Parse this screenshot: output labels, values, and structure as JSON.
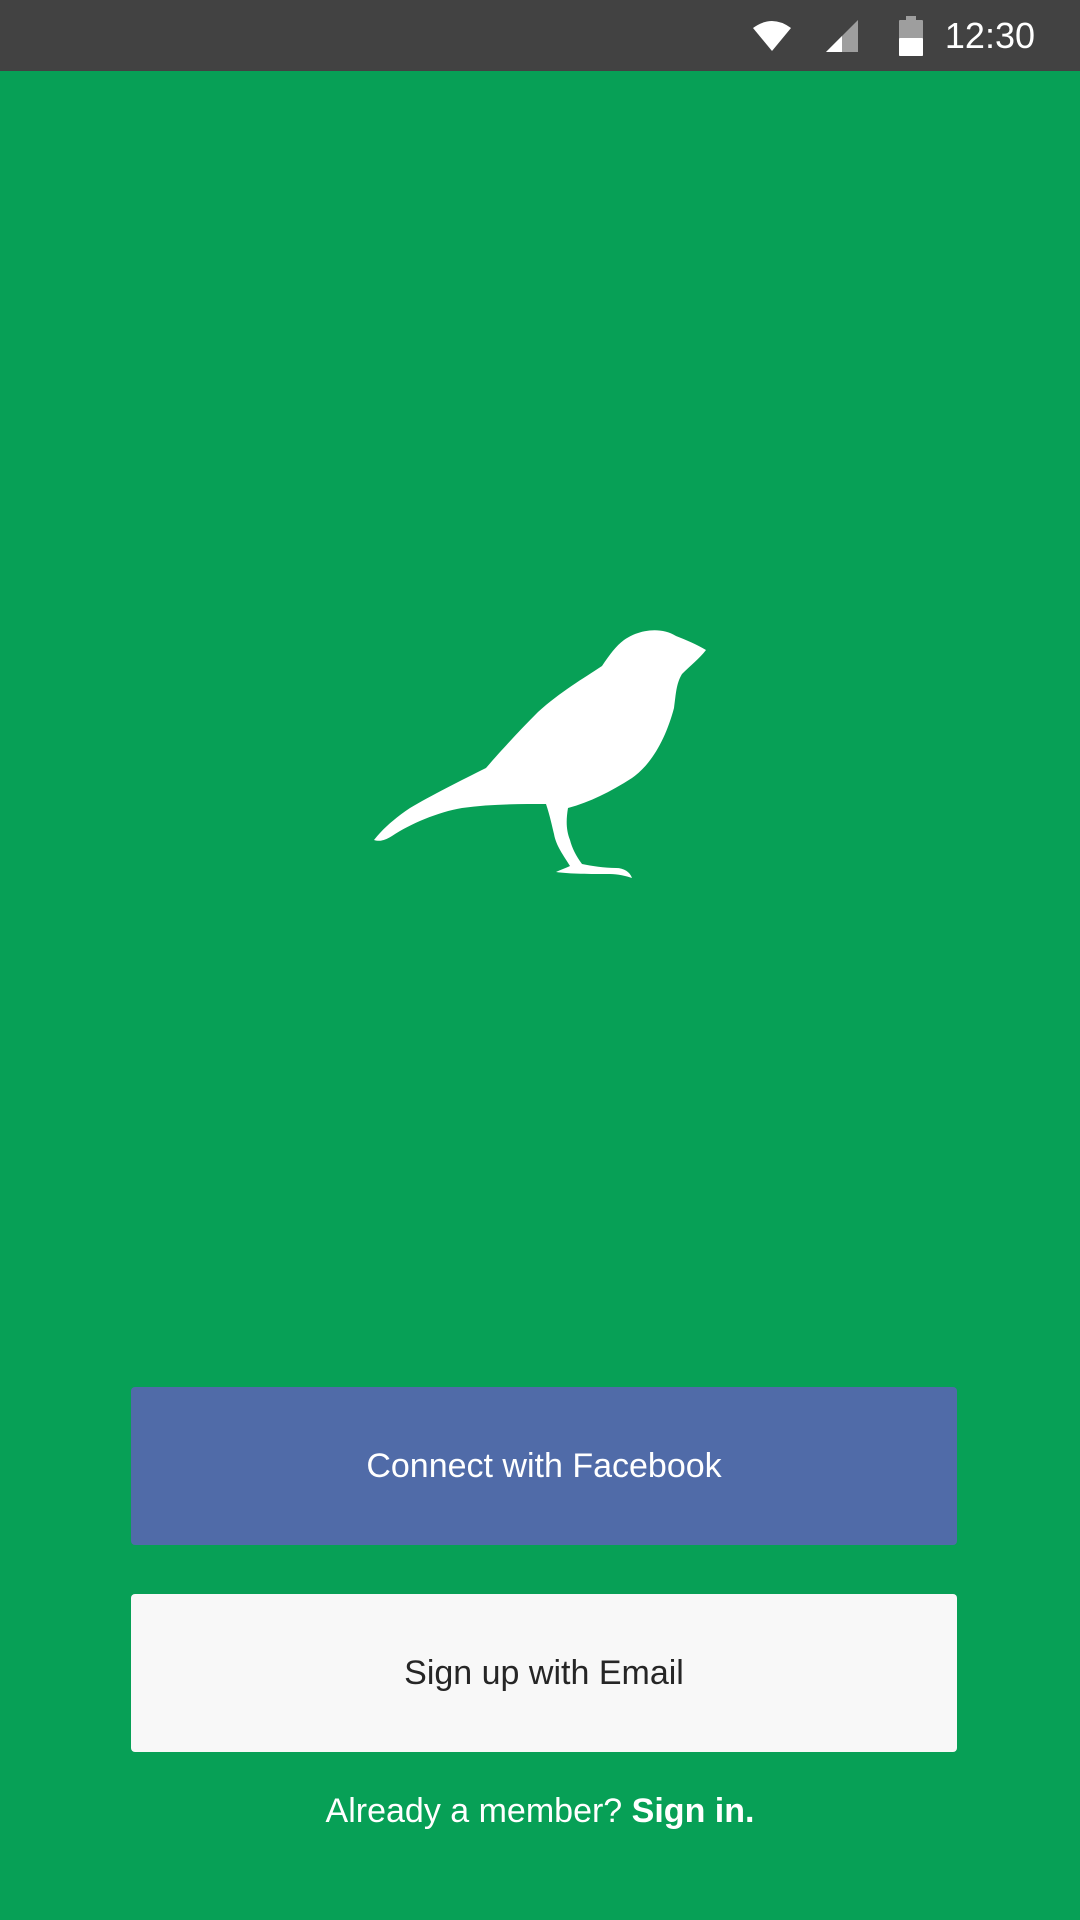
{
  "status_bar": {
    "time": "12:30",
    "icons": [
      "wifi-icon",
      "cellular-signal-icon",
      "battery-icon"
    ]
  },
  "logo": {
    "icon": "bird-logo"
  },
  "actions": {
    "facebook_label": "Connect with Facebook",
    "email_label": "Sign up with Email",
    "member_prompt": "Already a member?",
    "signin_label": "Sign in."
  },
  "colors": {
    "background": "#07a056",
    "status_bar": "#424242",
    "facebook_button": "#506ba8",
    "email_button": "#f8f8f8"
  }
}
